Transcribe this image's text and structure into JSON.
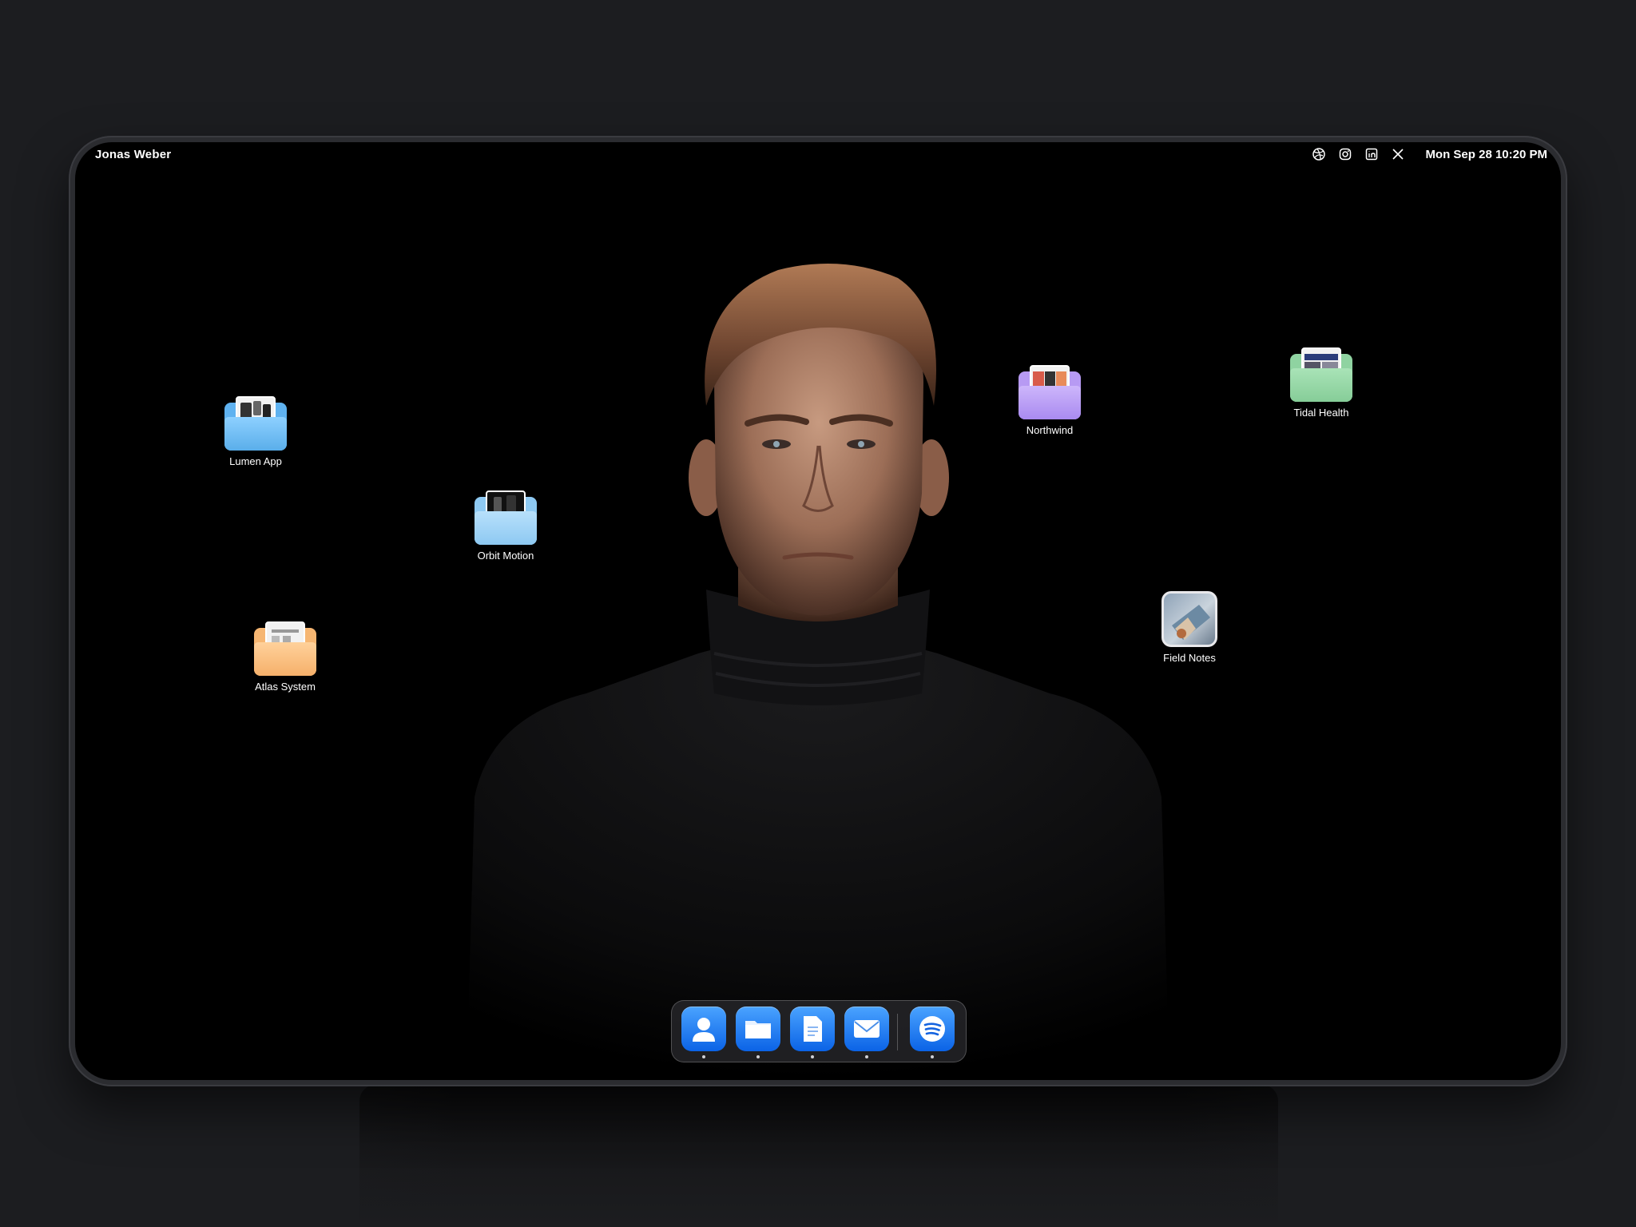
{
  "menubar": {
    "owner": "Jonas Weber",
    "socials": [
      "dribbble-icon",
      "instagram-icon",
      "linkedin-icon",
      "x-icon"
    ],
    "datetime": "Mon Sep 28 10:20 PM"
  },
  "desktop": {
    "icons": [
      {
        "label": "Lumen App",
        "kind": "folder",
        "color": "#5fb2f0"
      },
      {
        "label": "Orbit Motion",
        "kind": "folder",
        "color": "#8ec9f2"
      },
      {
        "label": "Atlas System",
        "kind": "folder",
        "color": "#f6b672"
      },
      {
        "label": "Northwind",
        "kind": "folder",
        "color": "#b79af3"
      },
      {
        "label": "Tidal Health",
        "kind": "folder",
        "color": "#8fd3a1"
      },
      {
        "label": "Field Notes",
        "kind": "photo"
      }
    ]
  },
  "dock": {
    "items": [
      "contacts-icon",
      "folder-icon",
      "document-icon",
      "mail-icon",
      "spotify-icon"
    ],
    "accent": "#0b63e6"
  },
  "colors": {
    "page_bg": "#1c1d20",
    "screen_bg": "#000000"
  }
}
